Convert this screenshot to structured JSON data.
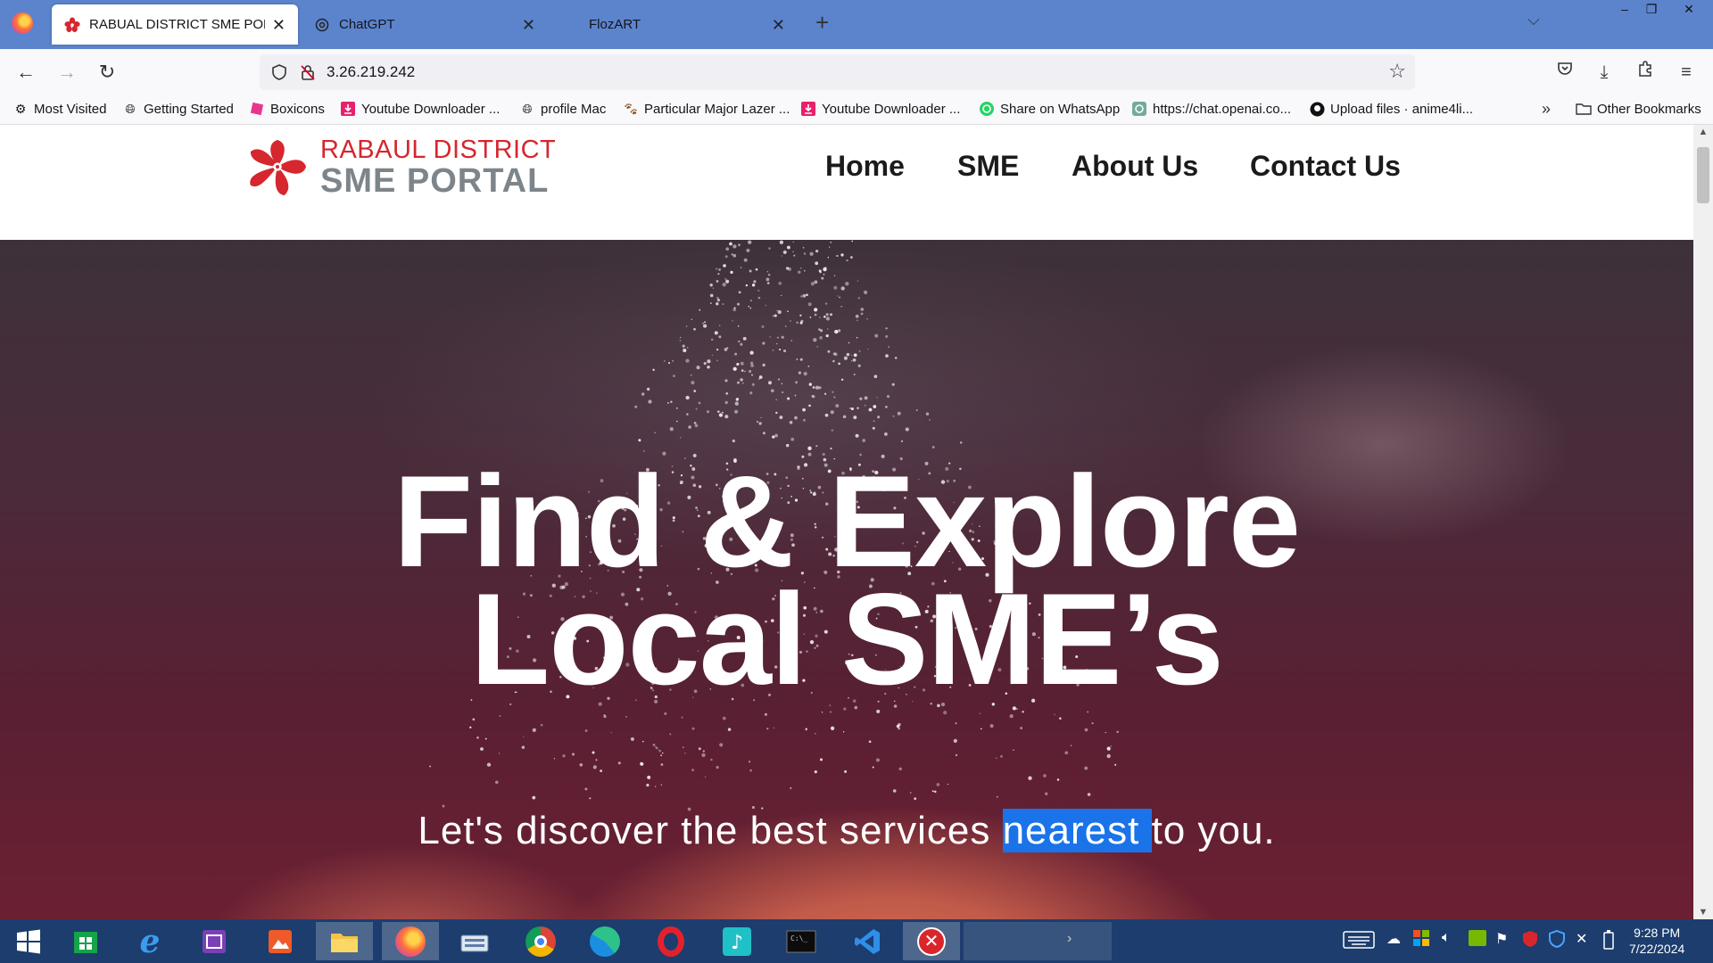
{
  "browser": {
    "tabs": [
      {
        "label": "RABUAL DISTRICT SME PORTAL",
        "icon": "hibiscus-icon",
        "active": true
      },
      {
        "label": "ChatGPT",
        "icon": "chatgpt-icon",
        "active": false
      },
      {
        "label": "FlozART",
        "icon": "",
        "active": false
      }
    ],
    "url": "3.26.219.242",
    "bookmarks": [
      {
        "label": "Most Visited",
        "icon": "gear-icon"
      },
      {
        "label": "Getting Started",
        "icon": "globe-icon"
      },
      {
        "label": "Boxicons",
        "icon": "boxicons-icon"
      },
      {
        "label": "Youtube Downloader ...",
        "icon": "download-icon"
      },
      {
        "label": "profile Mac",
        "icon": "globe-icon"
      },
      {
        "label": "Particular Major Lazer ...",
        "icon": "paw-icon"
      },
      {
        "label": "Youtube Downloader ...",
        "icon": "download-icon"
      },
      {
        "label": "Share on WhatsApp",
        "icon": "whatsapp-icon"
      },
      {
        "label": "https://chat.openai.co...",
        "icon": "chatgpt-icon"
      },
      {
        "label": "Upload files · anime4li...",
        "icon": "github-icon"
      }
    ],
    "other_bookmarks": "Other Bookmarks"
  },
  "site": {
    "logo_line1": "RABAUL DISTRICT",
    "logo_line2": "SME PORTAL",
    "nav": [
      "Home",
      "SME",
      "About Us",
      "Contact Us"
    ],
    "hero_title_line1": "Find & Explore",
    "hero_title_line2": "Local SME’s",
    "hero_sub_before": "Let's discover the best services ",
    "hero_sub_highlight": "nearest ",
    "hero_sub_after": "to you."
  },
  "taskbar": {
    "time": "9:28 PM",
    "date": "7/22/2024"
  },
  "colors": {
    "tabstrip": "#5b84cd",
    "brand_red": "#d6262e",
    "brand_gray": "#7d858a",
    "selection": "#1a73e8",
    "taskbar": "#1c3d6e"
  }
}
